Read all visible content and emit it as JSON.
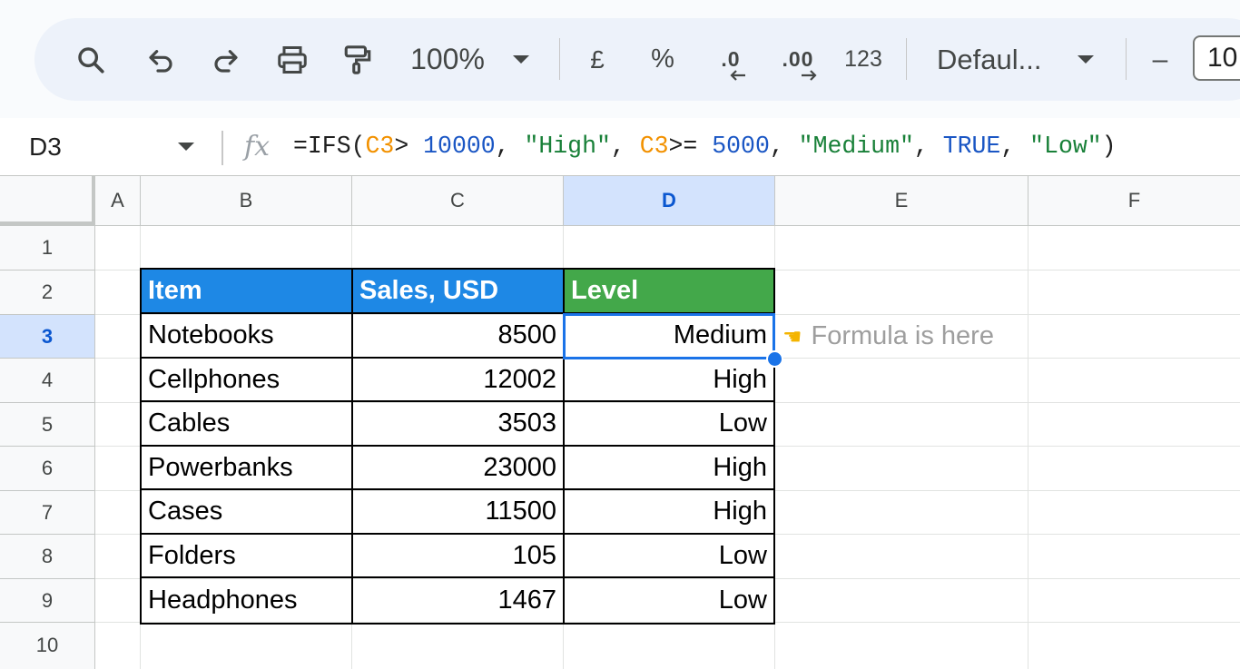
{
  "toolbar": {
    "zoom": "100%",
    "currency": "£",
    "percent": "%",
    "decrease_decimal": ".0",
    "increase_decimal": ".00",
    "number_format": "123",
    "font": "Defaul...",
    "font_size": "10",
    "minus": "–",
    "icons": [
      "search-icon",
      "undo-icon",
      "redo-icon",
      "print-icon",
      "paint-format-icon"
    ]
  },
  "formula_bar": {
    "name_box": "D3",
    "fx": "fx",
    "formula": {
      "t1": "=IFS(",
      "t2": "C3",
      "t3": "> ",
      "t4": "10000",
      "t5": ", ",
      "t6": "\"High\"",
      "t7": ", ",
      "t8": "C3",
      "t9": ">= ",
      "t10": "5000",
      "t11": ", ",
      "t12": "\"Medium\"",
      "t13": ", ",
      "t14": "TRUE",
      "t15": ", ",
      "t16": "\"Low\"",
      "t17": ")"
    }
  },
  "columns": [
    "A",
    "B",
    "C",
    "D",
    "E",
    "F"
  ],
  "rows": [
    "1",
    "2",
    "3",
    "4",
    "5",
    "6",
    "7",
    "8",
    "9",
    "10"
  ],
  "table": {
    "headers": [
      "Item",
      "Sales, USD",
      "Level"
    ],
    "header_colors": [
      "#1e88e5",
      "#1e88e5",
      "#43a84a"
    ],
    "data": [
      [
        "Notebooks",
        "8500",
        "Medium"
      ],
      [
        "Cellphones",
        "12002",
        "High"
      ],
      [
        "Cables",
        "3503",
        "Low"
      ],
      [
        "Powerbanks",
        "23000",
        "High"
      ],
      [
        "Cases",
        "11500",
        "High"
      ],
      [
        "Folders",
        "105",
        "Low"
      ],
      [
        "Headphones",
        "1467",
        "Low"
      ]
    ]
  },
  "selected_cell": "D3",
  "note": {
    "icon": "pointing-hand-icon",
    "text": "Formula is here"
  }
}
